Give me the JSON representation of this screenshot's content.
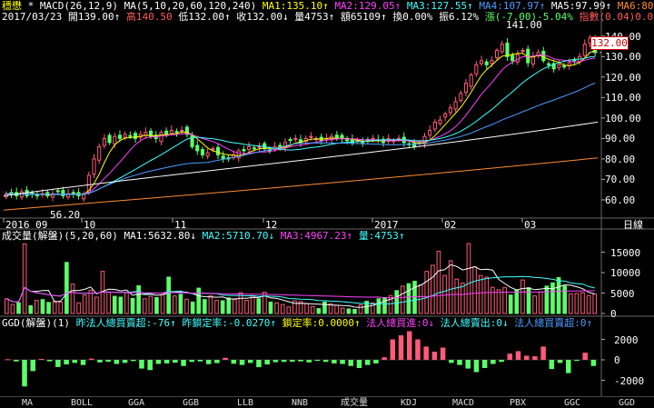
{
  "header": {
    "stock_name": "穩懋",
    "indicator_label": "* MACD(26,12,9)",
    "ma_params": "MA(5,10,20,60,120,240)",
    "ma1": "MA1:135.10↑",
    "ma2": "MA2:129.05↑",
    "ma3": "MA3:127.55↑",
    "ma4": "MA4:107.97↑",
    "ma5": "MA5:97.99↑",
    "ma6": "MA6:80.45↑",
    "date": "2017/03/23",
    "open": "開139.00↑",
    "high": "高140.50",
    "low": "低132.00↑",
    "close": "收132.00↓",
    "volume": "量4753↑",
    "amount": "額65109↑",
    "turnover": "換0.00%",
    "amplitude": "振6.12%",
    "change": "漲(-7.00)-5.04%",
    "index": "指數(0.04)0.03%"
  },
  "price_axis": [
    "140.00",
    "130.00",
    "120.00",
    "110.00",
    "100.00",
    "90.00",
    "80.00",
    "70.00",
    "60.00"
  ],
  "current_price": "132.00",
  "high_marker": "141.00",
  "low_marker": "56.20",
  "time_axis": [
    "2016 09",
    "10",
    "11",
    "12",
    "2017",
    "02",
    "03"
  ],
  "time_unit": "日線",
  "volume_panel": {
    "title": "成交量(解盤)(5,20,60)",
    "ma1": "MA1:5632.80↓",
    "ma2": "MA2:5710.70↓",
    "ma3": "MA3:4967.23↑",
    "vol": "量:4753↑",
    "axis": [
      "15000",
      "10000",
      "5000",
      "0"
    ]
  },
  "ggd_panel": {
    "title": "GGD(解盤)(1)",
    "l1": "昨法人總買賣超:-76↑",
    "l2": "昨鎖定率:-0.0270↑",
    "l3": "鎖定率:0.0000↑",
    "l4": "法人總買進:0↓",
    "l5": "法人總賣出:0↓",
    "l6": "法人總買賣超:0↑",
    "axis": [
      "2000",
      "0",
      "-2000"
    ]
  },
  "tabs": [
    "MA",
    "BOLL",
    "GGA",
    "GGB",
    "LLB",
    "NNB",
    "成交量",
    "KDJ",
    "MACD",
    "PBX",
    "GGC",
    "GGD"
  ],
  "colors": {
    "up": "#ff5a7a",
    "down": "#5cff6a",
    "ma1": "#ffff00",
    "ma2": "#ff40ff",
    "ma3": "#40ffff",
    "ma4": "#4a9cff",
    "ma5": "#ffffff",
    "ma6": "#ff8c30"
  },
  "chart_data": {
    "type": "candlestick",
    "price_range": [
      52,
      147
    ],
    "volume_range": [
      0,
      18000
    ],
    "ggd_range": [
      -3200,
      3200
    ],
    "price_path": [
      63,
      63,
      62,
      64,
      62,
      63,
      62,
      63,
      62,
      63,
      64,
      62,
      63,
      63,
      62,
      63,
      72,
      80,
      86,
      90,
      88,
      91,
      90,
      92,
      91,
      90,
      92,
      93,
      91,
      90,
      93,
      92,
      94,
      93,
      94,
      92,
      86,
      84,
      82,
      83,
      85,
      82,
      80,
      80,
      82,
      84,
      84,
      86,
      85,
      86,
      85,
      84,
      86,
      86,
      88,
      89,
      90,
      88,
      90,
      91,
      90,
      89,
      90,
      91,
      90,
      90,
      89,
      88,
      89,
      88,
      89,
      90,
      89,
      88,
      90,
      89,
      90,
      88,
      87,
      86,
      88,
      91,
      94,
      98,
      99,
      102,
      105,
      108,
      112,
      117,
      121,
      126,
      128,
      126,
      128,
      133,
      136,
      130,
      128,
      131,
      133,
      127,
      130,
      132,
      128,
      126,
      124,
      126,
      125,
      127,
      128,
      130,
      136,
      139,
      132
    ],
    "volume_values": [
      3600,
      2200,
      2600,
      17000,
      1900,
      3200,
      3400,
      2700,
      3000,
      2800,
      12500,
      7200,
      2600,
      4500,
      5700,
      4000,
      10300,
      5200,
      4200,
      4000,
      5100,
      3700,
      6800,
      3600,
      4200,
      3900,
      4600,
      8900,
      4300,
      4700,
      3500,
      2800,
      6200,
      3400,
      4300,
      3200,
      3100,
      3800,
      3400,
      5100,
      3200,
      4300,
      3600,
      5200,
      2800,
      2600,
      2200,
      1600,
      3100,
      2900,
      2400,
      1700,
      1200,
      2800,
      2400,
      2000,
      1300,
      1100,
      1000,
      2100,
      3000,
      2600,
      3600,
      3900,
      4400,
      5600,
      6700,
      7300,
      7900,
      7000,
      10300,
      11800,
      15200,
      9300,
      12900,
      8400,
      7400,
      17100,
      11400,
      9300,
      8900,
      6400,
      5800,
      6300,
      4500,
      5800,
      8200,
      6300,
      4300,
      5300,
      6700,
      7500,
      8800,
      6700,
      4800,
      4900,
      5100,
      4400,
      4753
    ],
    "ggd_values": [
      60,
      -150,
      -2600,
      -1100,
      90,
      -140,
      -700,
      -450,
      -300,
      -500,
      120,
      -250,
      -180,
      -400,
      -300,
      -120,
      -850,
      -1000,
      -400,
      -350,
      -280,
      -600,
      -200,
      -150,
      -420,
      -320,
      200,
      -380,
      -500,
      -300,
      -720,
      -450,
      -230,
      -200,
      -180,
      -150,
      -250,
      -100,
      -200,
      -350,
      -400,
      -600,
      -800,
      -500,
      -350,
      250,
      2000,
      2400,
      2800,
      2000,
      1300,
      800,
      1200,
      -300,
      -500,
      -850,
      -1200,
      -800,
      -400,
      -200,
      600,
      850,
      400,
      350,
      1300,
      -900,
      -300,
      -1300,
      -100,
      700,
      -600
    ],
    "ma_series_description": "MA1..MA6 overlays"
  }
}
